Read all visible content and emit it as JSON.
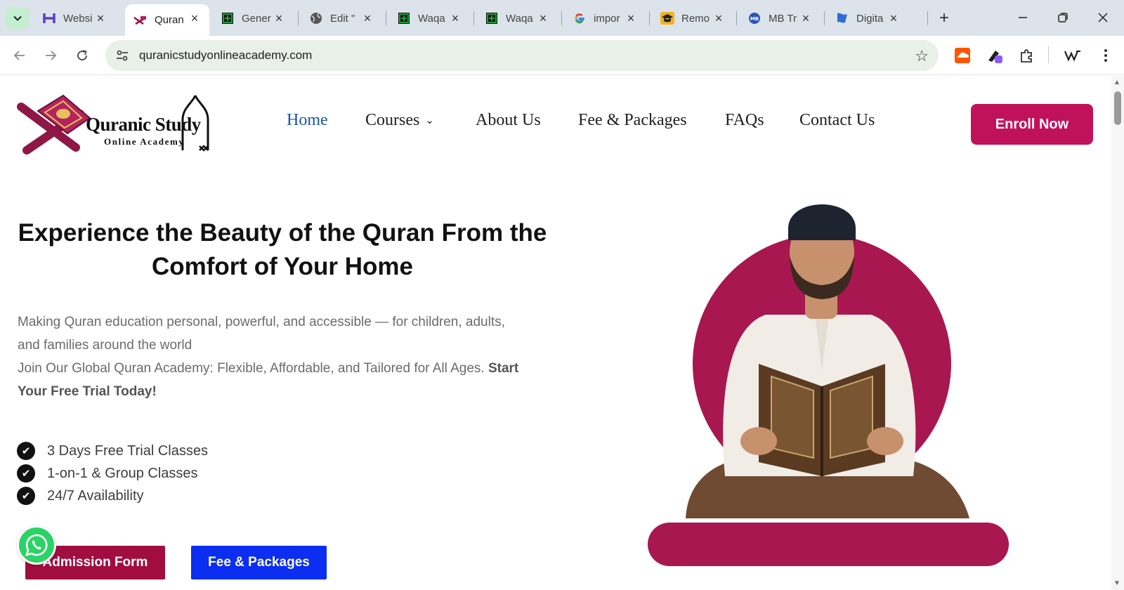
{
  "browser": {
    "tabs": [
      {
        "title": "Websi",
        "favicon": "h-logo-icon",
        "color": "#5b3fc7"
      },
      {
        "title": "Quran",
        "favicon": "quran-stand-icon",
        "active": true
      },
      {
        "title": "Gener",
        "favicon": "green-grid-icon",
        "color": "#1aa33a"
      },
      {
        "title": "Edit \"",
        "favicon": "globe-icon"
      },
      {
        "title": "Waqa",
        "favicon": "green-grid-icon",
        "color": "#1aa33a"
      },
      {
        "title": "Waqa",
        "favicon": "green-grid-icon",
        "color": "#1aa33a"
      },
      {
        "title": "impor",
        "favicon": "google-icon"
      },
      {
        "title": "Remo",
        "favicon": "mortarboard-icon",
        "color": "#f2b31b"
      },
      {
        "title": "MB Tr",
        "favicon": "mb-logo-icon",
        "color": "#2a55b8"
      },
      {
        "title": "Digita",
        "favicon": "flag-icon",
        "color": "#2f6bd8"
      }
    ],
    "url": "quranicstudyonlineacademy.com"
  },
  "site": {
    "logo": {
      "brand": "Quranic Study",
      "sub": "Online Academy"
    },
    "nav": {
      "home": "Home",
      "courses": "Courses",
      "about": "About Us",
      "fees": "Fee & Packages",
      "faqs": "FAQs",
      "contact": "Contact Us"
    },
    "enroll_label": "Enroll Now",
    "hero": {
      "title_line1": "Experience the Beauty of the Quran From the",
      "title_line2": "Comfort of Your Home",
      "desc_line1": "Making Quran education personal, powerful, and accessible — for children, adults,",
      "desc_line2": "and families around the world",
      "desc_line3": "Join Our Global Quran Academy: Flexible, Affordable, and Tailored for All Ages.",
      "desc_cta": "Start Your Free Trial Today!",
      "features": [
        "3 Days Free Trial Classes",
        "1-on-1 & Group Classes",
        "24/7 Availability"
      ],
      "admission_label": "Admission Form",
      "fee_label": "Fee & Packages"
    },
    "colors": {
      "brand": "#c0125a",
      "nav_active": "#1a56a8",
      "fee_button": "#0b2ef0",
      "admission_button": "#a10d3f",
      "hero_circle": "#a8174f",
      "whatsapp": "#2bd366"
    }
  }
}
